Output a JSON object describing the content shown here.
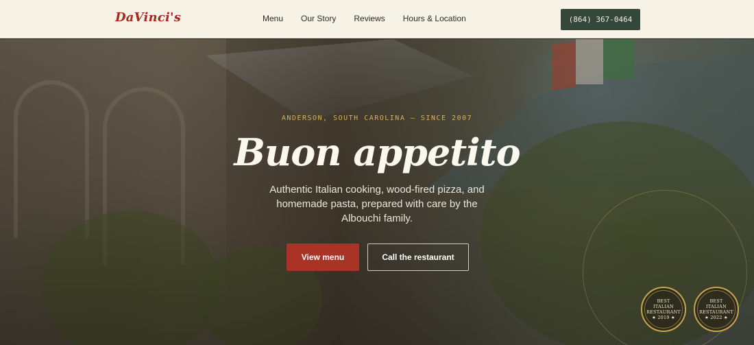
{
  "header": {
    "logo": "DaVinci's",
    "nav": [
      "Menu",
      "Our Story",
      "Reviews",
      "Hours & Location"
    ],
    "phone_button": "(864) 367-0464"
  },
  "hero": {
    "eyebrow": "ANDERSON, SOUTH CAROLINA — SINCE 2007",
    "headline": "Buon appetito",
    "subtitle": "Authentic Italian cooking, wood-fired pizza, and homemade pasta, prepared with care by the Albouchi family.",
    "primary_button": "View menu",
    "secondary_button": "Call the restaurant"
  },
  "badges": [
    {
      "line1": "BEST",
      "line2": "ITALIAN",
      "line3": "RESTAURANT",
      "line4": "★ 2019 ★"
    },
    {
      "line1": "BEST",
      "line2": "ITALIAN",
      "line3": "RESTAURANT",
      "line4": "★ 2022 ★"
    }
  ],
  "colors": {
    "brand_red": "#a52a1f",
    "accent_green": "#33473a",
    "gold": "#d9b25a"
  }
}
